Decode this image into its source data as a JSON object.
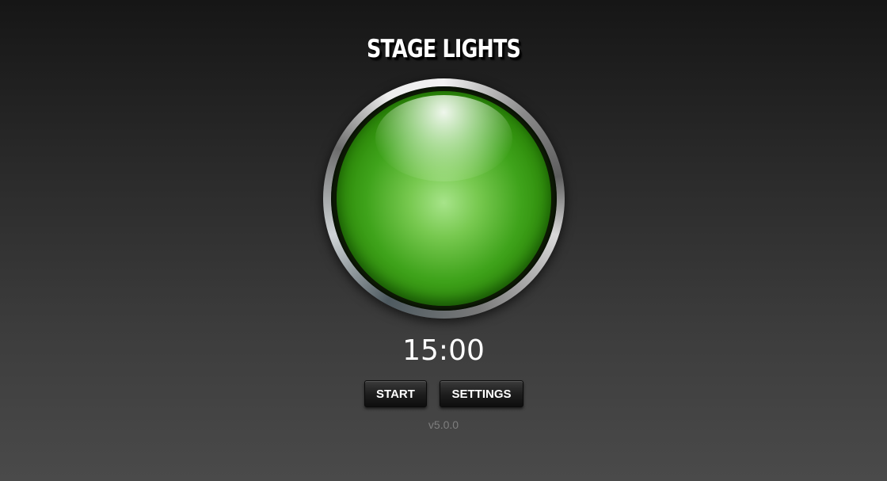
{
  "app": {
    "title": "STAGE LIGHTS",
    "version": "v5.0.0"
  },
  "light": {
    "state": "green",
    "color": "#3fa31b",
    "icon": "stage-light-icon"
  },
  "timer": {
    "display": "15:00"
  },
  "controls": {
    "start_label": "START",
    "settings_label": "SETTINGS"
  },
  "colors": {
    "background_top": "#161616",
    "background_bottom": "#4a4a4a",
    "button_text": "#ffffff",
    "version_text": "#7e7e7e"
  }
}
